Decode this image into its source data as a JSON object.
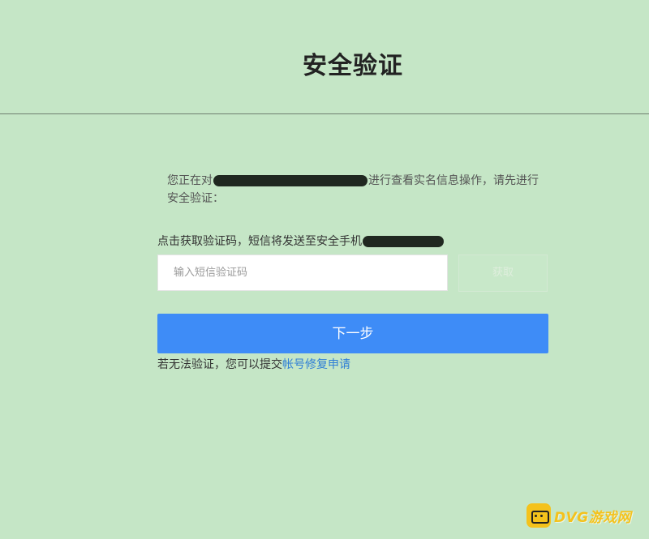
{
  "header": {
    "title": "安全验证"
  },
  "notice": {
    "prefix": "您正在对",
    "suffix": "进行查看实名信息操作，请先进行安全验证："
  },
  "sms": {
    "tip": "点击获取验证码，短信将发送至安全手机"
  },
  "code_input": {
    "placeholder": "输入短信验证码",
    "value": ""
  },
  "send_button": {
    "label": "获取"
  },
  "next_button": {
    "label": "下一步"
  },
  "repair": {
    "text": "若无法验证，您可以提交",
    "link_label": "帐号修复申请"
  },
  "watermark": {
    "text": "DVG游戏网"
  },
  "colors": {
    "background": "#c5e6c6",
    "primary": "#3e8cf7",
    "link": "#2e7ed6"
  }
}
